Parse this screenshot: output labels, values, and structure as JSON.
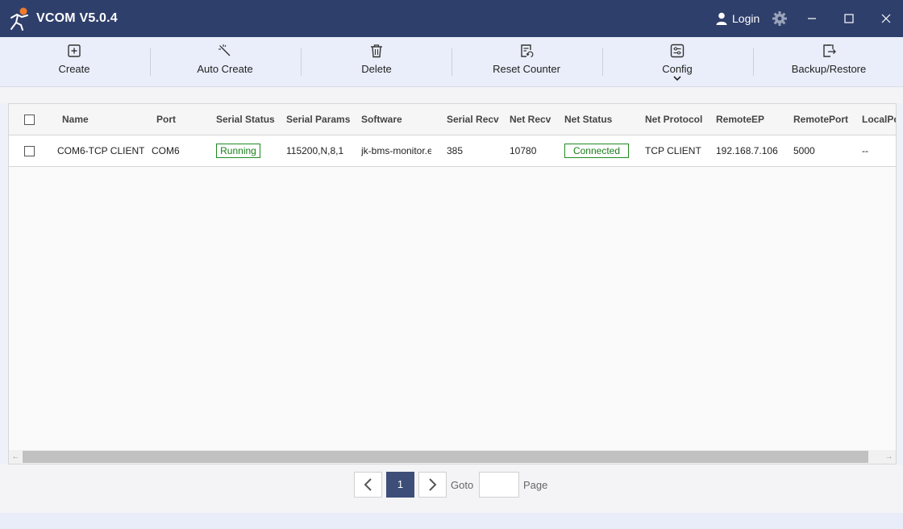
{
  "app": {
    "title": "VCOM V5.0.4",
    "login_label": "Login"
  },
  "colors": {
    "titlebar": "#2f3f6b",
    "accent": "#3d4e78",
    "status_green": "#1a7f1a"
  },
  "toolbar": {
    "items": [
      {
        "label": "Create",
        "icon": "plus-square-icon"
      },
      {
        "label": "Auto Create",
        "icon": "magic-wand-icon"
      },
      {
        "label": "Delete",
        "icon": "trash-icon"
      },
      {
        "label": "Reset Counter",
        "icon": "reset-counter-icon"
      },
      {
        "label": "Config",
        "icon": "sliders-icon"
      },
      {
        "label": "Backup/Restore",
        "icon": "export-icon"
      }
    ]
  },
  "table": {
    "columns": [
      "Name",
      "Port",
      "Serial Status",
      "Serial Params",
      "Software",
      "Serial Recv",
      "Net Recv",
      "Net Status",
      "Net Protocol",
      "RemoteEP",
      "RemotePort",
      "LocalPo"
    ],
    "rows": [
      {
        "name": "COM6-TCP CLIENT",
        "port": "COM6",
        "serial_status": "Running",
        "serial_params": "115200,N,8,1",
        "software": "jk-bms-monitor.e",
        "serial_recv": "385",
        "net_recv": "10780",
        "net_status": "Connected",
        "net_protocol": "TCP CLIENT",
        "remote_ep": "192.168.7.106",
        "remote_port": "5000",
        "local_port": "--"
      }
    ]
  },
  "pagination": {
    "current_page": "1",
    "goto_label": "Goto",
    "page_label": "Page",
    "goto_value": ""
  }
}
